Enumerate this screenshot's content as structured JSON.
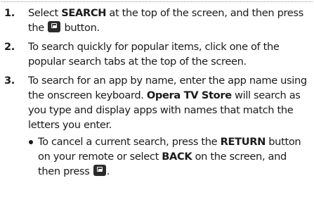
{
  "steps": [
    {
      "number": "1.",
      "parts": [
        "Select ",
        "SEARCH",
        " at the top of the screen, and then press the ",
        " button."
      ],
      "icon": "enter-key-icon"
    },
    {
      "number": "2.",
      "text": "To search quickly for popular items, click one of the popular search tabs at the top of the screen."
    },
    {
      "number": "3.",
      "parts": [
        "To search for an app by name, enter the app name using the onscreen keyboard. ",
        "Opera TV Store",
        " will search as you type and display apps with names that match the letters you enter."
      ],
      "sub": {
        "parts": [
          "To cancel a current search, press the ",
          "RETURN",
          " button on your remote or select ",
          "BACK",
          " on the screen, and then press ",
          "."
        ],
        "icon": "enter-key-icon"
      }
    }
  ]
}
